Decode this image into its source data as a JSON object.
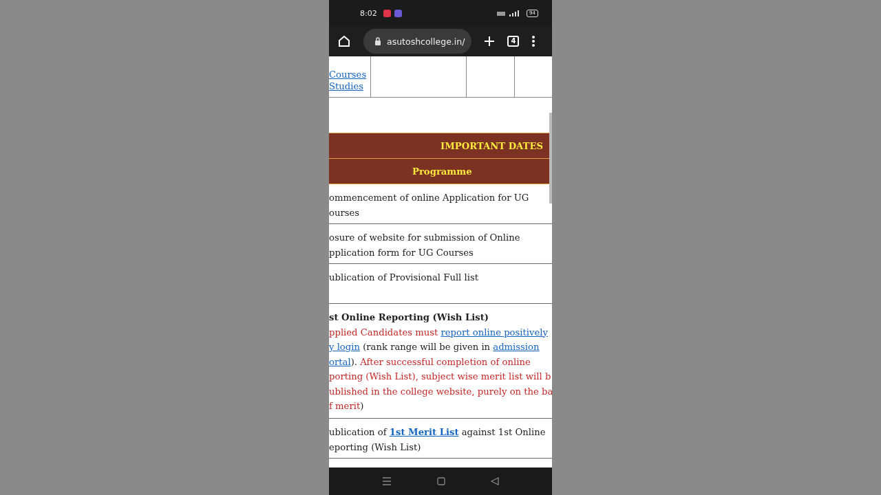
{
  "status_bar": {
    "time": "8:02",
    "battery": "94"
  },
  "browser": {
    "url": "asutoshcollege.in/",
    "tab_count": "4"
  },
  "top_table": {
    "links": [
      "Courses",
      "Studies"
    ]
  },
  "dates_table": {
    "title": "IMPORTANT DATES",
    "column_header": "Programme",
    "rows": [
      {
        "kind": "plain",
        "text": "ommencement of online Application for UG\nourses"
      },
      {
        "kind": "plain",
        "text": "osure of website for submission of Online\npplication form for UG Courses"
      },
      {
        "kind": "plain",
        "text": "ublication of Provisional Full list"
      },
      {
        "kind": "rich",
        "heading": "st Online Reporting (Wish List)",
        "segments": [
          {
            "kind": "red",
            "text": "pplied Candidates must "
          },
          {
            "kind": "link",
            "text": "report online positively"
          },
          {
            "kind": "break"
          },
          {
            "kind": "link",
            "text": "y login"
          },
          {
            "kind": "black",
            "text": " (rank range will be given in "
          },
          {
            "kind": "link",
            "text": "admission"
          },
          {
            "kind": "break"
          },
          {
            "kind": "link",
            "text": "ortal"
          },
          {
            "kind": "black",
            "text": "). "
          },
          {
            "kind": "red",
            "text": "After successful completion of online\nporting (Wish List), subject wise merit list will b\nublished in the college website, purely on the ba\nf merit"
          },
          {
            "kind": "black",
            "text": ")"
          }
        ]
      },
      {
        "kind": "rich",
        "segments": [
          {
            "kind": "black",
            "text": "ublication of "
          },
          {
            "kind": "boldlink",
            "text": "1st Merit List"
          },
          {
            "kind": "black",
            "text": " against 1st Online\neporting (Wish List)"
          }
        ]
      }
    ]
  }
}
